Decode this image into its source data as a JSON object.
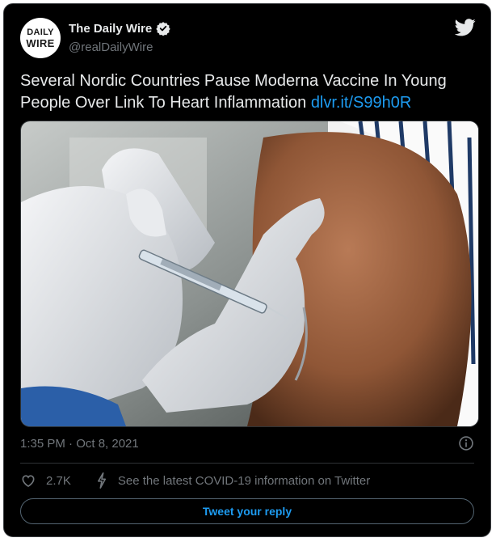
{
  "tweet": {
    "avatar_text_line1": "DAILY",
    "avatar_text_line2": "WIRE",
    "author_name": "The Daily Wire",
    "author_handle": "@realDailyWire",
    "verified": true,
    "text": "Several Nordic Countries Pause Moderna Vaccine In Young People Over Link To Heart Inflammation ",
    "link_text": "dlvr.it/S99h0R",
    "timestamp": "1:35 PM · Oct 8, 2021",
    "like_count": "2.7K",
    "info_banner": "See the latest COVID-19 information on Twitter",
    "reply_label": "Tweet your reply"
  },
  "icons": {
    "brand": "twitter-bird-icon",
    "verified": "verified-badge-icon",
    "info": "info-icon",
    "like": "heart-icon",
    "covid": "lightning-icon"
  },
  "colors": {
    "background": "#000000",
    "text": "#e7e9ea",
    "secondary_text": "#71767b",
    "accent": "#1d9bf0"
  }
}
